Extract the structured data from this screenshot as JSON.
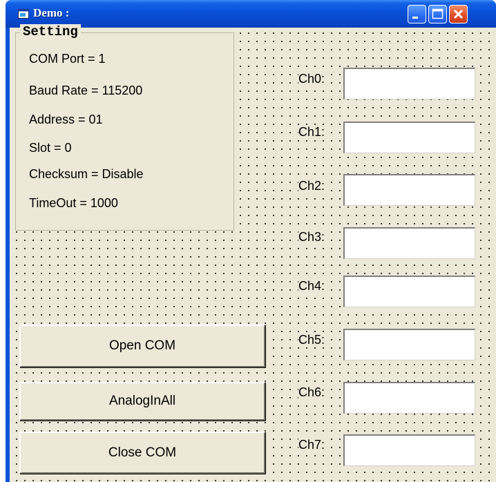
{
  "window": {
    "title": "Demo :",
    "controls": [
      "minimize-icon",
      "maximize-icon",
      "close-icon"
    ]
  },
  "setting": {
    "title": "Setting",
    "lines": [
      "COM Port = 1",
      "Baud Rate = 115200",
      "Address = 01",
      "Slot = 0",
      "Checksum = Disable",
      "TimeOut = 1000"
    ]
  },
  "buttons": {
    "open_com": "Open COM",
    "analog_in_all": "AnalogInAll",
    "close_com": "Close COM"
  },
  "channels": [
    {
      "label": "Ch0:",
      "value": ""
    },
    {
      "label": "Ch1:",
      "value": ""
    },
    {
      "label": "Ch2:",
      "value": ""
    },
    {
      "label": "Ch3:",
      "value": ""
    },
    {
      "label": "Ch4:",
      "value": ""
    },
    {
      "label": "Ch5:",
      "value": ""
    },
    {
      "label": "Ch6:",
      "value": ""
    },
    {
      "label": "Ch7:",
      "value": ""
    }
  ],
  "colors": {
    "titlebar": "#0a50d8",
    "form_background": "#ece9d8",
    "close_button": "#e0502a"
  }
}
